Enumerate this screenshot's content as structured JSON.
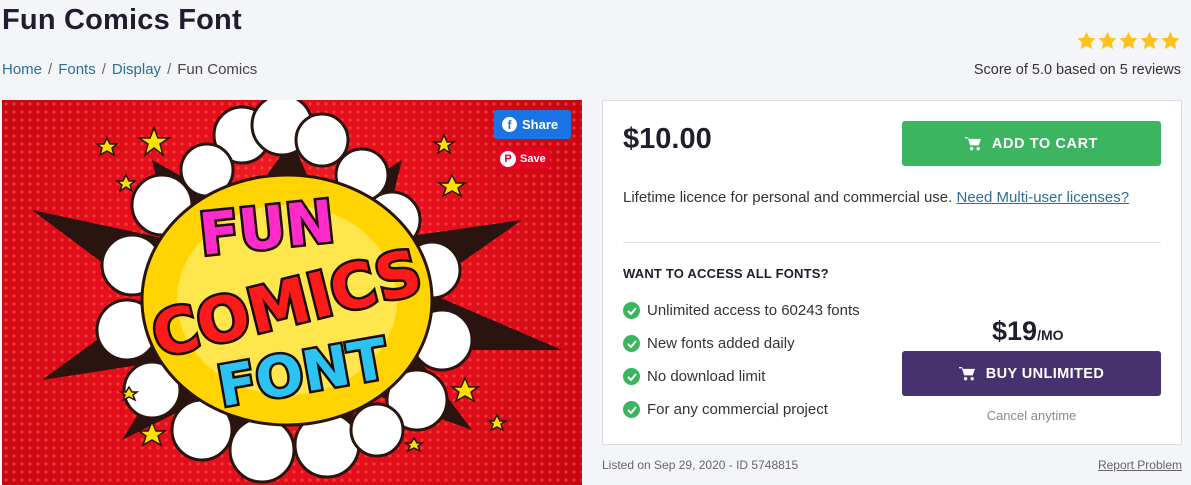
{
  "page": {
    "title": "Fun Comics Font"
  },
  "breadcrumb": [
    {
      "label": "Home"
    },
    {
      "label": "Fonts"
    },
    {
      "label": "Display"
    },
    {
      "label": "Fun Comics"
    }
  ],
  "rating": {
    "stars": 5,
    "max": 5,
    "score_text": "Score of 5.0 based on 5 reviews",
    "star_color": "#ffc21a"
  },
  "hero": {
    "art_lines": [
      "FUN",
      "COMICS",
      "FONT"
    ],
    "share_label": "Share",
    "save_label": "Save"
  },
  "purchase": {
    "price": "$10.00",
    "add_to_cart_label": "ADD TO CART",
    "licence_text": "Lifetime licence for personal and commercial use.",
    "licence_link": "Need Multi-user licenses?",
    "cart_color": "#3cb561"
  },
  "unlimited": {
    "title": "WANT TO ACCESS ALL FONTS?",
    "features": [
      "Unlimited access to 60243 fonts",
      "New fonts added daily",
      "No download limit",
      "For any commercial project"
    ],
    "price": "$19",
    "per": "/MO",
    "button_label": "BUY UNLIMITED",
    "cancel_text": "Cancel anytime",
    "button_color": "#46326f"
  },
  "footer": {
    "listed_text": "Listed on Sep 29, 2020 - ID 5748815",
    "report_label": "Report Problem"
  }
}
